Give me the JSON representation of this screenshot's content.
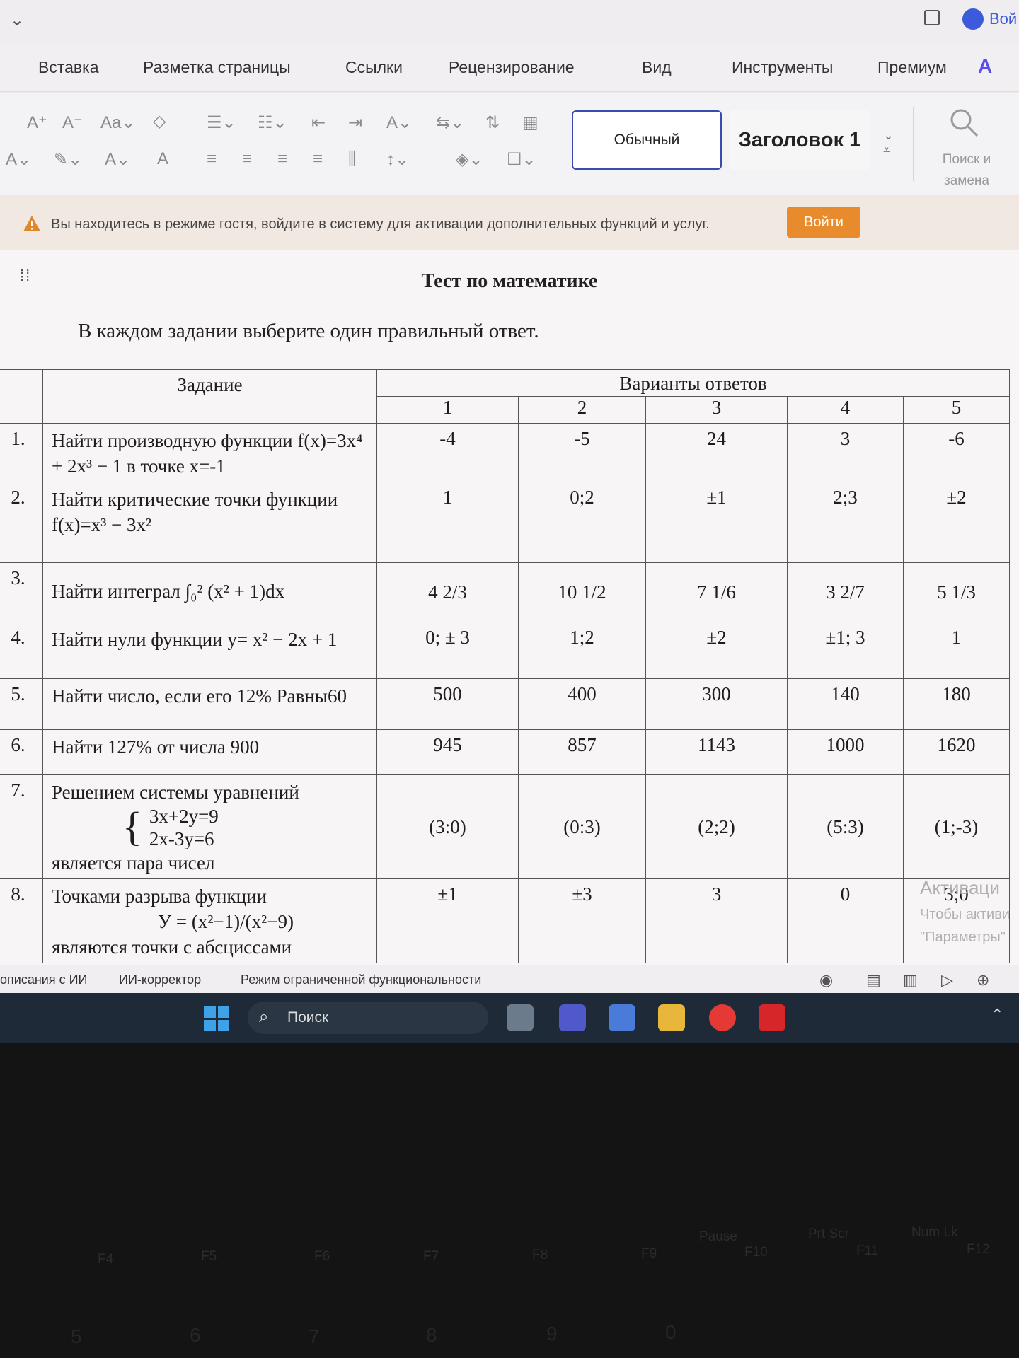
{
  "titlebar": {
    "login_label": "Вой"
  },
  "menu": {
    "items": [
      "Вставка",
      "Разметка страницы",
      "Ссылки",
      "Рецензирование",
      "Вид",
      "Инструменты",
      "Премиум"
    ]
  },
  "ribbon": {
    "style_normal": "Обычный",
    "style_heading1": "Заголовок 1",
    "find_replace": "Поиск и замена"
  },
  "guest_banner": {
    "text": "Вы находитесь в режиме гостя, войдите в систему для активации дополнительных функций и услуг.",
    "login_button": "Войти"
  },
  "document": {
    "title": "Тест по математике",
    "instruction": "В каждом задании выберите один правильный ответ.",
    "table": {
      "header_task": "Задание",
      "header_variants": "Варианты ответов",
      "variant_numbers": [
        "1",
        "2",
        "3",
        "4",
        "5"
      ],
      "rows": [
        {
          "num": "1.",
          "task": "Найти производную функции f(x)=3x⁴ + 2x³ − 1 в точке x=-1",
          "answers": [
            "-4",
            "-5",
            "24",
            "3",
            "-6"
          ]
        },
        {
          "num": "2.",
          "task": "Найти критические точки функции f(x)=x³ − 3x²",
          "answers": [
            "1",
            "0;2",
            "±1",
            "2;3",
            "±2"
          ]
        },
        {
          "num": "3.",
          "task": "Найти интеграл ∫₀² (x² + 1)dx",
          "answers": [
            "4 2/3",
            "10 1/2",
            "7 1/6",
            "3 2/7",
            "5 1/3"
          ]
        },
        {
          "num": "4.",
          "task": "Найти нули функции y= x² − 2x + 1",
          "answers": [
            "0; ± 3",
            "1;2",
            "±2",
            "±1; 3",
            "1"
          ]
        },
        {
          "num": "5.",
          "task": "Найти число, если его 12% Равны60",
          "answers": [
            "500",
            "400",
            "300",
            "140",
            "180"
          ]
        },
        {
          "num": "6.",
          "task": "Найти 127% от числа 900",
          "answers": [
            "945",
            "857",
            "1143",
            "1000",
            "1620"
          ]
        },
        {
          "num": "7.",
          "task_intro": "Решением системы уравнений",
          "eq1": "3x+2y=9",
          "eq2": "2x-3y=6",
          "task_outro": "является пара чисел",
          "answers": [
            "(3:0)",
            "(0:3)",
            "(2;2)",
            "(5:3)",
            "(1;-3)"
          ]
        },
        {
          "num": "8.",
          "task_intro": "Точками разрыва функции",
          "formula": "У = (x²−1)/(x²−9)",
          "task_outro": "являются точки с абсциссами",
          "answers": [
            "±1",
            "±3",
            "3",
            "0",
            "3;0"
          ]
        }
      ]
    }
  },
  "watermark": {
    "title": "Активаци",
    "line1": "Чтобы активи",
    "line2": "\"Параметры\""
  },
  "statusbar": {
    "item1": "описания с ИИ",
    "item2": "ИИ-корректор",
    "item3": "Режим ограниченной функциональности"
  },
  "taskbar": {
    "search_label": "Поиск"
  },
  "keyboard": {
    "fn_keys": [
      "F4",
      "F5",
      "F6",
      "F7",
      "F8",
      "F9",
      "F10",
      "F11",
      "F12"
    ],
    "special": [
      "Pause",
      "Prt Scr",
      "Num Lk"
    ],
    "digits": [
      "5",
      "6",
      "7",
      "8",
      "9",
      "0"
    ]
  }
}
